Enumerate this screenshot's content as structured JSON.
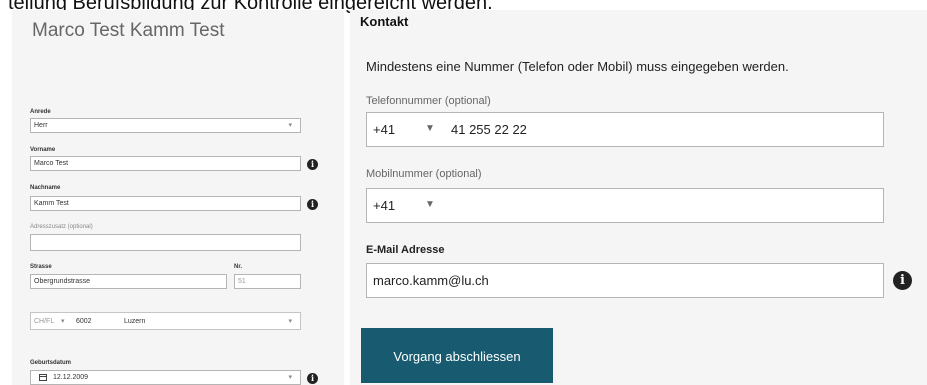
{
  "page": {
    "cut_text": "teilung Berufsbildung zur Kontrolle eingereicht werden."
  },
  "person": {
    "title": "Marco Test Kamm Test",
    "anrede": {
      "label": "Anrede",
      "value": "Herr"
    },
    "vorname": {
      "label": "Vorname",
      "value": "Marco Test"
    },
    "nachname": {
      "label": "Nachname",
      "value": "Kamm Test"
    },
    "adresszusatz": {
      "label": "Adresszusatz (optional)",
      "value": ""
    },
    "strasse": {
      "label": "Strasse",
      "value": "Obergrundstrasse"
    },
    "nr": {
      "label": "Nr.",
      "value": "51"
    },
    "country": "CH/FL",
    "plz": "6002",
    "ort": "Luzern",
    "geburtsdatum": {
      "label": "Geburtsdatum",
      "value": "12.12.2009"
    }
  },
  "contact": {
    "title": "Kontakt",
    "note": "Mindestens eine Nummer (Telefon oder Mobil) muss eingegeben werden.",
    "telefon": {
      "label": "Telefonnummer (optional)",
      "prefix": "+41",
      "value": "41 255 22 22"
    },
    "mobil": {
      "label": "Mobilnummer  (optional)",
      "prefix": "+41",
      "value": ""
    },
    "email": {
      "label": "E-Mail Adresse",
      "value": "marco.kamm@lu.ch"
    },
    "submit_label": "Vorgang abschliessen"
  },
  "icons": {
    "info": "info-icon",
    "dropdown": "caret-down-icon",
    "calendar": "calendar-icon"
  }
}
